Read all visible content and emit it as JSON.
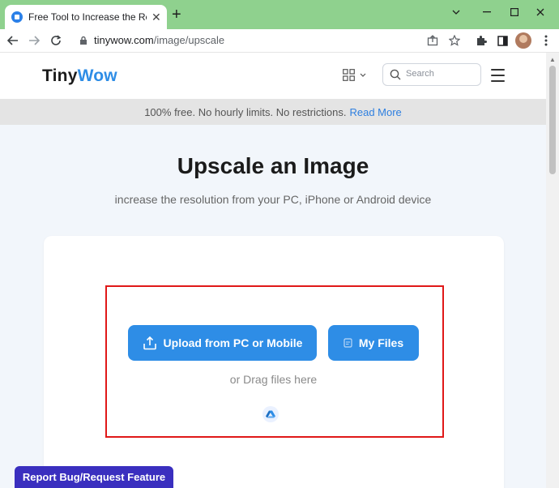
{
  "browser": {
    "tab_title": "Free Tool to Increase the Resolution",
    "url_host": "tinywow.com",
    "url_path": "/image/upscale"
  },
  "site": {
    "logo_main": "Tiny",
    "logo_accent": "Wow",
    "search_placeholder": "Search"
  },
  "banner": {
    "text": "100% free. No hourly limits. No restrictions.",
    "link": "Read More"
  },
  "hero": {
    "title": "Upscale an Image",
    "subtitle": "increase the resolution from your PC, iPhone or Android device"
  },
  "upload": {
    "upload_label": "Upload from PC or Mobile",
    "files_label": "My Files",
    "drag_text": "or Drag files here"
  },
  "footer": {
    "report_label": "Report Bug/Request Feature"
  },
  "colors": {
    "accent": "#2e8de6",
    "highlight": "#e01818",
    "chrome_bar": "#8fd18e",
    "report": "#3a2fbf"
  },
  "icons": [
    "tinywow-favicon",
    "close-icon",
    "plus-icon",
    "minimize-icon",
    "maximize-icon",
    "chevron-down-icon",
    "back-arrow-icon",
    "forward-arrow-icon",
    "reload-icon",
    "lock-icon",
    "share-icon",
    "star-icon",
    "extensions-icon",
    "sidebar-icon",
    "kebab-menu-icon",
    "apps-grid-icon",
    "search-icon",
    "hamburger-icon",
    "upload-icon",
    "file-icon",
    "google-drive-icon"
  ]
}
